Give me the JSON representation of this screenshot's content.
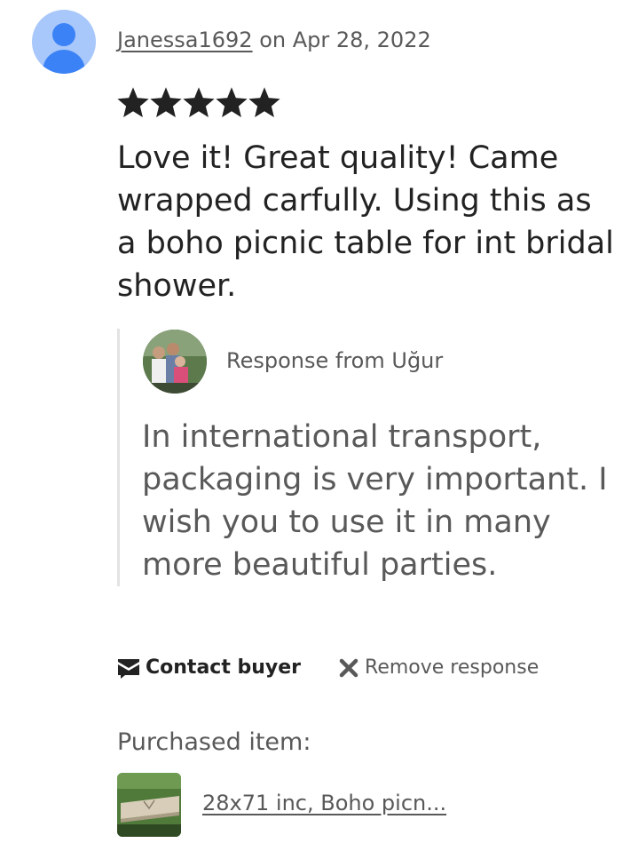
{
  "review": {
    "username": "Janessa1692",
    "date_text": " on Apr 28, 2022",
    "rating": 5,
    "rating_max": 5,
    "text": "Love it! Great quality! Came wrapped carfully. Using this as a boho picnic table for int bridal shower."
  },
  "response": {
    "from_label": "Response from Uğur",
    "text": "In international transport, packaging is very important. I wish you to use it in many more beautiful parties."
  },
  "actions": {
    "contact_label": "Contact buyer",
    "contact_icon": "envelope-icon",
    "remove_label": "Remove response",
    "remove_icon": "close-icon"
  },
  "purchased": {
    "label": "Purchased item:",
    "item_title": "28x71 inc, Boho picn..."
  },
  "colors": {
    "star": "#222222",
    "avatar_bg": "#a8c7fa",
    "avatar_fg": "#3b82f6",
    "muted_text": "#595959",
    "divider": "#e3e3e3"
  }
}
